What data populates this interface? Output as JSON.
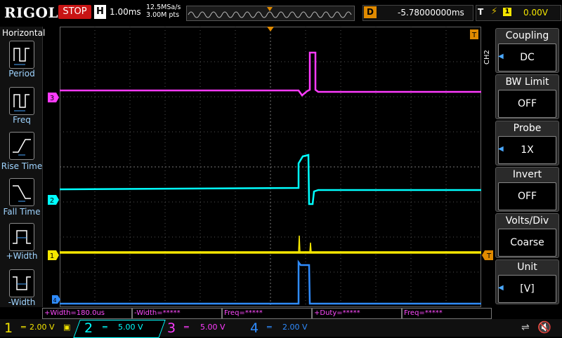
{
  "header": {
    "logo": "RIGOL",
    "run_state": "STOP",
    "timebase_label": "H",
    "timebase_value": "1.00ms",
    "sample_rate": "12.5MSa/s",
    "memory_depth": "3.00M pts",
    "delay_label": "D",
    "delay_value": "-5.78000000ms",
    "trigger_label": "T",
    "trigger_source": "1",
    "trigger_level": "0.00V"
  },
  "left_panel": {
    "title": "Horizontal",
    "items": [
      {
        "label": "Period",
        "icon": "period-icon"
      },
      {
        "label": "Freq",
        "icon": "freq-icon"
      },
      {
        "label": "Rise Time",
        "icon": "rise-time-icon"
      },
      {
        "label": "Fall Time",
        "icon": "fall-time-icon"
      },
      {
        "label": "+Width",
        "icon": "positive-width-icon"
      },
      {
        "label": "-Width",
        "icon": "negative-width-icon"
      }
    ]
  },
  "right_panel": {
    "channel_tag": "CH2",
    "menus": [
      {
        "title": "Coupling",
        "value": "DC"
      },
      {
        "title": "BW Limit",
        "value": "OFF"
      },
      {
        "title": "Probe",
        "value": "1X"
      },
      {
        "title": "Invert",
        "value": "OFF"
      },
      {
        "title": "Volts/Div",
        "value": "Coarse"
      },
      {
        "title": "Unit",
        "value": "[V]"
      }
    ]
  },
  "waveform_markers": {
    "ch1": "1",
    "ch2": "2",
    "ch3": "3",
    "ch4": "4",
    "trigger_marker": "T"
  },
  "measurements": [
    {
      "label": "+Width=180.0us"
    },
    {
      "label": "-Width=*****"
    },
    {
      "label": "Freq=*****"
    },
    {
      "label": "+Duty=*****"
    },
    {
      "label": "Freq=*****"
    }
  ],
  "channels": [
    {
      "num": "1",
      "scale": "2.00 V",
      "color": "#f5e600"
    },
    {
      "num": "2",
      "scale": "5.00 V",
      "color": "#00ffff"
    },
    {
      "num": "3",
      "scale": "5.00 V",
      "color": "#ff3bff"
    },
    {
      "num": "4",
      "scale": "2.00 V",
      "color": "#2f8cff"
    }
  ],
  "colors": {
    "ch1": "#f5e600",
    "ch2": "#00ffff",
    "ch3": "#ff3bff",
    "ch4": "#2f8cff",
    "stop": "#c81414",
    "delay": "#e08a00"
  }
}
